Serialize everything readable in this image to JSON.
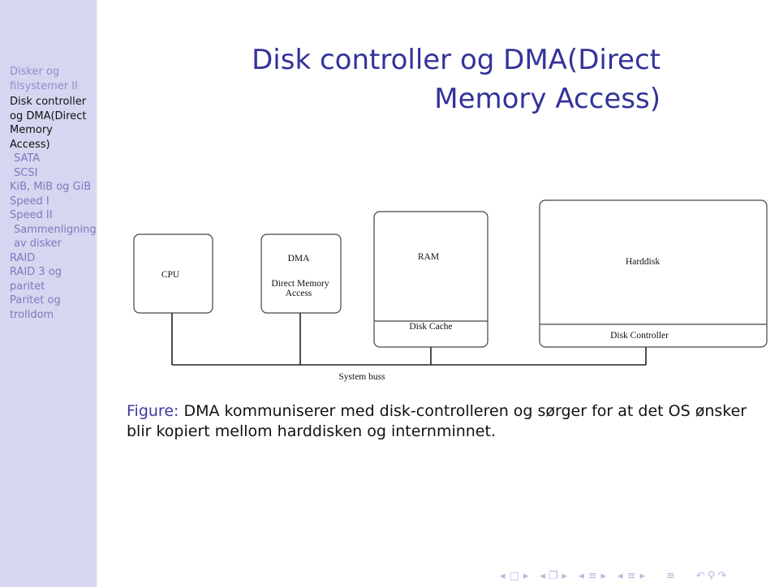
{
  "sidebar": {
    "section": "Disker og filsystemer II",
    "items": [
      {
        "label": "Disk controller og DMA(Direct Memory Access)",
        "active": true,
        "sub": false
      },
      {
        "label": "SATA",
        "active": false,
        "sub": true
      },
      {
        "label": "SCSI",
        "active": false,
        "sub": true
      },
      {
        "label": "KiB, MiB og GiB",
        "active": false,
        "sub": false
      },
      {
        "label": "Speed I",
        "active": false,
        "sub": false
      },
      {
        "label": "Speed II",
        "active": false,
        "sub": false
      },
      {
        "label": "Sammenligning av disker",
        "active": false,
        "sub": true
      },
      {
        "label": "RAID",
        "active": false,
        "sub": false
      },
      {
        "label": "RAID 3 og paritet",
        "active": false,
        "sub": false
      },
      {
        "label": "Paritet og trolldom",
        "active": false,
        "sub": false
      }
    ]
  },
  "slide": {
    "title_line1": "Disk controller og DMA(Direct",
    "title_line2": "Memory Access)"
  },
  "diagram": {
    "cpu": "CPU",
    "dma_title": "DMA",
    "dma_line1": "Direct Memory",
    "dma_line2": "Access",
    "ram": "RAM",
    "disk_cache": "Disk Cache",
    "harddisk": "Harddisk",
    "disk_controller": "Disk Controller",
    "bus": "System buss"
  },
  "caption": {
    "prefix": "Figure:",
    "text": "DMA kommuniserer med disk-controlleren og sørger for at det OS ønsker blir kopiert mellom harddisken og internminnet."
  },
  "navigation": {
    "icons": [
      "nav-left-arrow",
      "frame-icon",
      "nav-right-arrow",
      "nav-left-arrow",
      "subsection-icon",
      "nav-right-arrow",
      "nav-left-arrow",
      "section-icon",
      "nav-right-arrow",
      "nav-left-arrow",
      "outline-icon",
      "nav-right-arrow",
      "outline-icon",
      "undo-icon",
      "search-icon",
      "redo-icon"
    ]
  }
}
